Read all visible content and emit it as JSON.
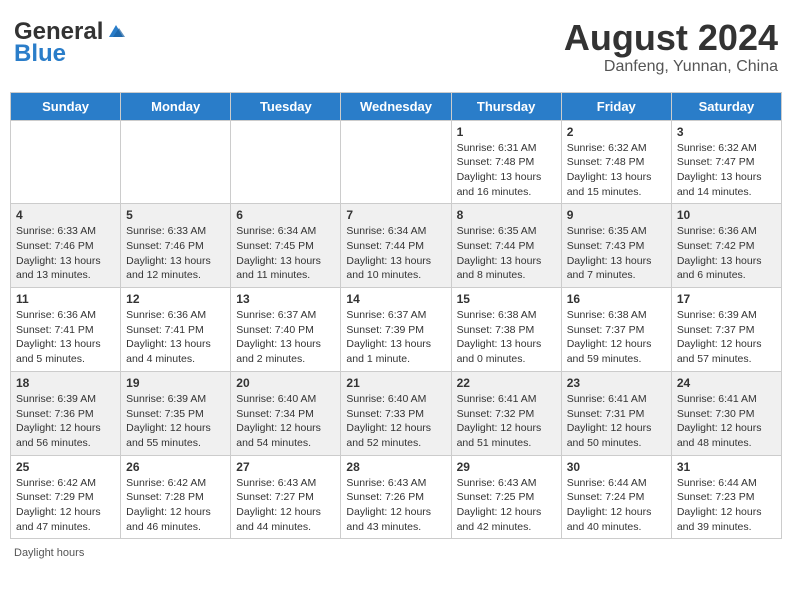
{
  "header": {
    "logo_general": "General",
    "logo_blue": "Blue",
    "main_title": "August 2024",
    "subtitle": "Danfeng, Yunnan, China"
  },
  "calendar": {
    "days_of_week": [
      "Sunday",
      "Monday",
      "Tuesday",
      "Wednesday",
      "Thursday",
      "Friday",
      "Saturday"
    ],
    "weeks": [
      {
        "row_class": "row-odd",
        "days": [
          {
            "num": "",
            "info": ""
          },
          {
            "num": "",
            "info": ""
          },
          {
            "num": "",
            "info": ""
          },
          {
            "num": "",
            "info": ""
          },
          {
            "num": "1",
            "info": "Sunrise: 6:31 AM\nSunset: 7:48 PM\nDaylight: 13 hours\nand 16 minutes."
          },
          {
            "num": "2",
            "info": "Sunrise: 6:32 AM\nSunset: 7:48 PM\nDaylight: 13 hours\nand 15 minutes."
          },
          {
            "num": "3",
            "info": "Sunrise: 6:32 AM\nSunset: 7:47 PM\nDaylight: 13 hours\nand 14 minutes."
          }
        ]
      },
      {
        "row_class": "row-even",
        "days": [
          {
            "num": "4",
            "info": "Sunrise: 6:33 AM\nSunset: 7:46 PM\nDaylight: 13 hours\nand 13 minutes."
          },
          {
            "num": "5",
            "info": "Sunrise: 6:33 AM\nSunset: 7:46 PM\nDaylight: 13 hours\nand 12 minutes."
          },
          {
            "num": "6",
            "info": "Sunrise: 6:34 AM\nSunset: 7:45 PM\nDaylight: 13 hours\nand 11 minutes."
          },
          {
            "num": "7",
            "info": "Sunrise: 6:34 AM\nSunset: 7:44 PM\nDaylight: 13 hours\nand 10 minutes."
          },
          {
            "num": "8",
            "info": "Sunrise: 6:35 AM\nSunset: 7:44 PM\nDaylight: 13 hours\nand 8 minutes."
          },
          {
            "num": "9",
            "info": "Sunrise: 6:35 AM\nSunset: 7:43 PM\nDaylight: 13 hours\nand 7 minutes."
          },
          {
            "num": "10",
            "info": "Sunrise: 6:36 AM\nSunset: 7:42 PM\nDaylight: 13 hours\nand 6 minutes."
          }
        ]
      },
      {
        "row_class": "row-odd",
        "days": [
          {
            "num": "11",
            "info": "Sunrise: 6:36 AM\nSunset: 7:41 PM\nDaylight: 13 hours\nand 5 minutes."
          },
          {
            "num": "12",
            "info": "Sunrise: 6:36 AM\nSunset: 7:41 PM\nDaylight: 13 hours\nand 4 minutes."
          },
          {
            "num": "13",
            "info": "Sunrise: 6:37 AM\nSunset: 7:40 PM\nDaylight: 13 hours\nand 2 minutes."
          },
          {
            "num": "14",
            "info": "Sunrise: 6:37 AM\nSunset: 7:39 PM\nDaylight: 13 hours\nand 1 minute."
          },
          {
            "num": "15",
            "info": "Sunrise: 6:38 AM\nSunset: 7:38 PM\nDaylight: 13 hours\nand 0 minutes."
          },
          {
            "num": "16",
            "info": "Sunrise: 6:38 AM\nSunset: 7:37 PM\nDaylight: 12 hours\nand 59 minutes."
          },
          {
            "num": "17",
            "info": "Sunrise: 6:39 AM\nSunset: 7:37 PM\nDaylight: 12 hours\nand 57 minutes."
          }
        ]
      },
      {
        "row_class": "row-even",
        "days": [
          {
            "num": "18",
            "info": "Sunrise: 6:39 AM\nSunset: 7:36 PM\nDaylight: 12 hours\nand 56 minutes."
          },
          {
            "num": "19",
            "info": "Sunrise: 6:39 AM\nSunset: 7:35 PM\nDaylight: 12 hours\nand 55 minutes."
          },
          {
            "num": "20",
            "info": "Sunrise: 6:40 AM\nSunset: 7:34 PM\nDaylight: 12 hours\nand 54 minutes."
          },
          {
            "num": "21",
            "info": "Sunrise: 6:40 AM\nSunset: 7:33 PM\nDaylight: 12 hours\nand 52 minutes."
          },
          {
            "num": "22",
            "info": "Sunrise: 6:41 AM\nSunset: 7:32 PM\nDaylight: 12 hours\nand 51 minutes."
          },
          {
            "num": "23",
            "info": "Sunrise: 6:41 AM\nSunset: 7:31 PM\nDaylight: 12 hours\nand 50 minutes."
          },
          {
            "num": "24",
            "info": "Sunrise: 6:41 AM\nSunset: 7:30 PM\nDaylight: 12 hours\nand 48 minutes."
          }
        ]
      },
      {
        "row_class": "row-odd",
        "days": [
          {
            "num": "25",
            "info": "Sunrise: 6:42 AM\nSunset: 7:29 PM\nDaylight: 12 hours\nand 47 minutes."
          },
          {
            "num": "26",
            "info": "Sunrise: 6:42 AM\nSunset: 7:28 PM\nDaylight: 12 hours\nand 46 minutes."
          },
          {
            "num": "27",
            "info": "Sunrise: 6:43 AM\nSunset: 7:27 PM\nDaylight: 12 hours\nand 44 minutes."
          },
          {
            "num": "28",
            "info": "Sunrise: 6:43 AM\nSunset: 7:26 PM\nDaylight: 12 hours\nand 43 minutes."
          },
          {
            "num": "29",
            "info": "Sunrise: 6:43 AM\nSunset: 7:25 PM\nDaylight: 12 hours\nand 42 minutes."
          },
          {
            "num": "30",
            "info": "Sunrise: 6:44 AM\nSunset: 7:24 PM\nDaylight: 12 hours\nand 40 minutes."
          },
          {
            "num": "31",
            "info": "Sunrise: 6:44 AM\nSunset: 7:23 PM\nDaylight: 12 hours\nand 39 minutes."
          }
        ]
      }
    ]
  },
  "footer": {
    "daylight_label": "Daylight hours"
  }
}
